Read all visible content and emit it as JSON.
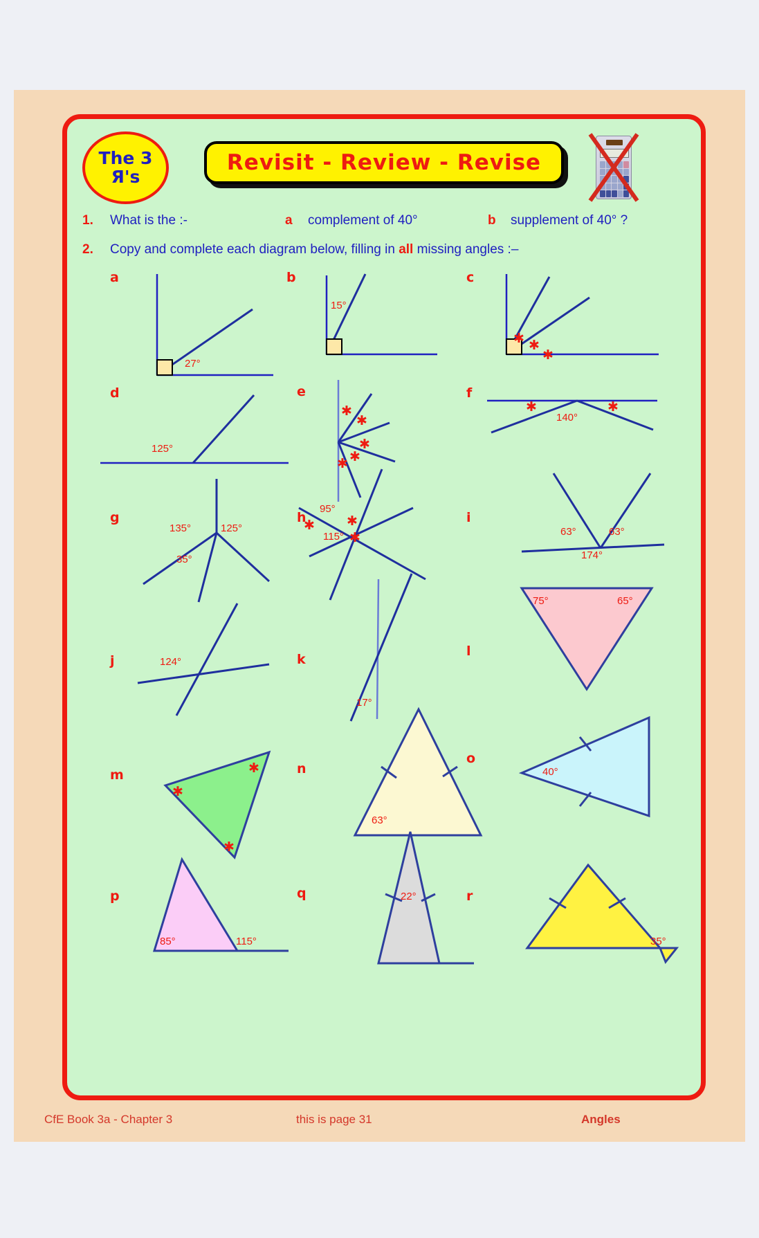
{
  "header": {
    "badge_line1": "The 3",
    "badge_line2": "Я's",
    "banner": "Revisit   -   Review   -   Revise",
    "calculator_icon": "calculator-not-allowed-icon"
  },
  "questions": [
    {
      "number": "1.",
      "stem": "What is the :-",
      "parts": [
        {
          "letter": "a",
          "text": "complement of 40°"
        },
        {
          "letter": "b",
          "text": "supplement of 40° ?"
        }
      ]
    },
    {
      "number": "2.",
      "stem_before": "Copy and complete each diagram below, filling in ",
      "stem_emph": "all",
      "stem_after": " missing angles :–"
    }
  ],
  "diagrams": {
    "a": {
      "label": "a",
      "angles": [
        "27°"
      ],
      "stars": 0,
      "right_angle": true
    },
    "b": {
      "label": "b",
      "angles": [
        "15°"
      ],
      "stars": 0,
      "right_angle": true
    },
    "c": {
      "label": "c",
      "angles": [],
      "stars": 3,
      "right_angle": true
    },
    "d": {
      "label": "d",
      "angles": [
        "125°"
      ],
      "stars": 0,
      "right_angle": false
    },
    "e": {
      "label": "e",
      "angles": [],
      "stars": 5,
      "right_angle": false
    },
    "f": {
      "label": "f",
      "angles": [
        "140°"
      ],
      "stars": 2,
      "right_angle": false
    },
    "g": {
      "label": "g",
      "angles": [
        "135°",
        "125°",
        "35°"
      ],
      "stars": 0
    },
    "h": {
      "label": "h",
      "angles": [
        "95°",
        "115°"
      ],
      "stars": 3
    },
    "i": {
      "label": "i",
      "angles": [
        "63°",
        "63°",
        "174°"
      ],
      "stars": 0
    },
    "j": {
      "label": "j",
      "angles": [
        "124°"
      ],
      "stars": 0
    },
    "k": {
      "label": "k",
      "angles": [
        "17°"
      ],
      "stars": 0
    },
    "l": {
      "label": "l",
      "angles": [
        "75°",
        "65°"
      ],
      "stars": 0,
      "fill": "#fcc9cf"
    },
    "m": {
      "label": "m",
      "angles": [],
      "stars": 3,
      "fill": "#8cf08c"
    },
    "n": {
      "label": "n",
      "angles": [
        "63°"
      ],
      "stars": 0,
      "fill": "#fcf8d2",
      "ticks": 2
    },
    "o": {
      "label": "o",
      "angles": [
        "40°"
      ],
      "stars": 0,
      "fill": "#caf4fb",
      "ticks": 2
    },
    "p": {
      "label": "p",
      "angles": [
        "85°",
        "115°"
      ],
      "stars": 0,
      "fill": "#fbcdf7"
    },
    "q": {
      "label": "q",
      "angles": [
        "22°"
      ],
      "stars": 0,
      "fill": "#dcdcdc",
      "ticks": 2
    },
    "r": {
      "label": "r",
      "angles": [
        "35°"
      ],
      "stars": 0,
      "fill": "#fff242",
      "ticks": 2
    }
  },
  "footer": {
    "left": "CfE Book 3a - Chapter 3",
    "center": "this is page 31",
    "right": "Angles"
  },
  "colors": {
    "red": "#ee1b11",
    "blue": "#2020c0",
    "navy": "#1f2f9e",
    "page_bg": "#f5d9b8",
    "sheet_bg": "#ccf5cc",
    "yellow": "#fff200"
  }
}
